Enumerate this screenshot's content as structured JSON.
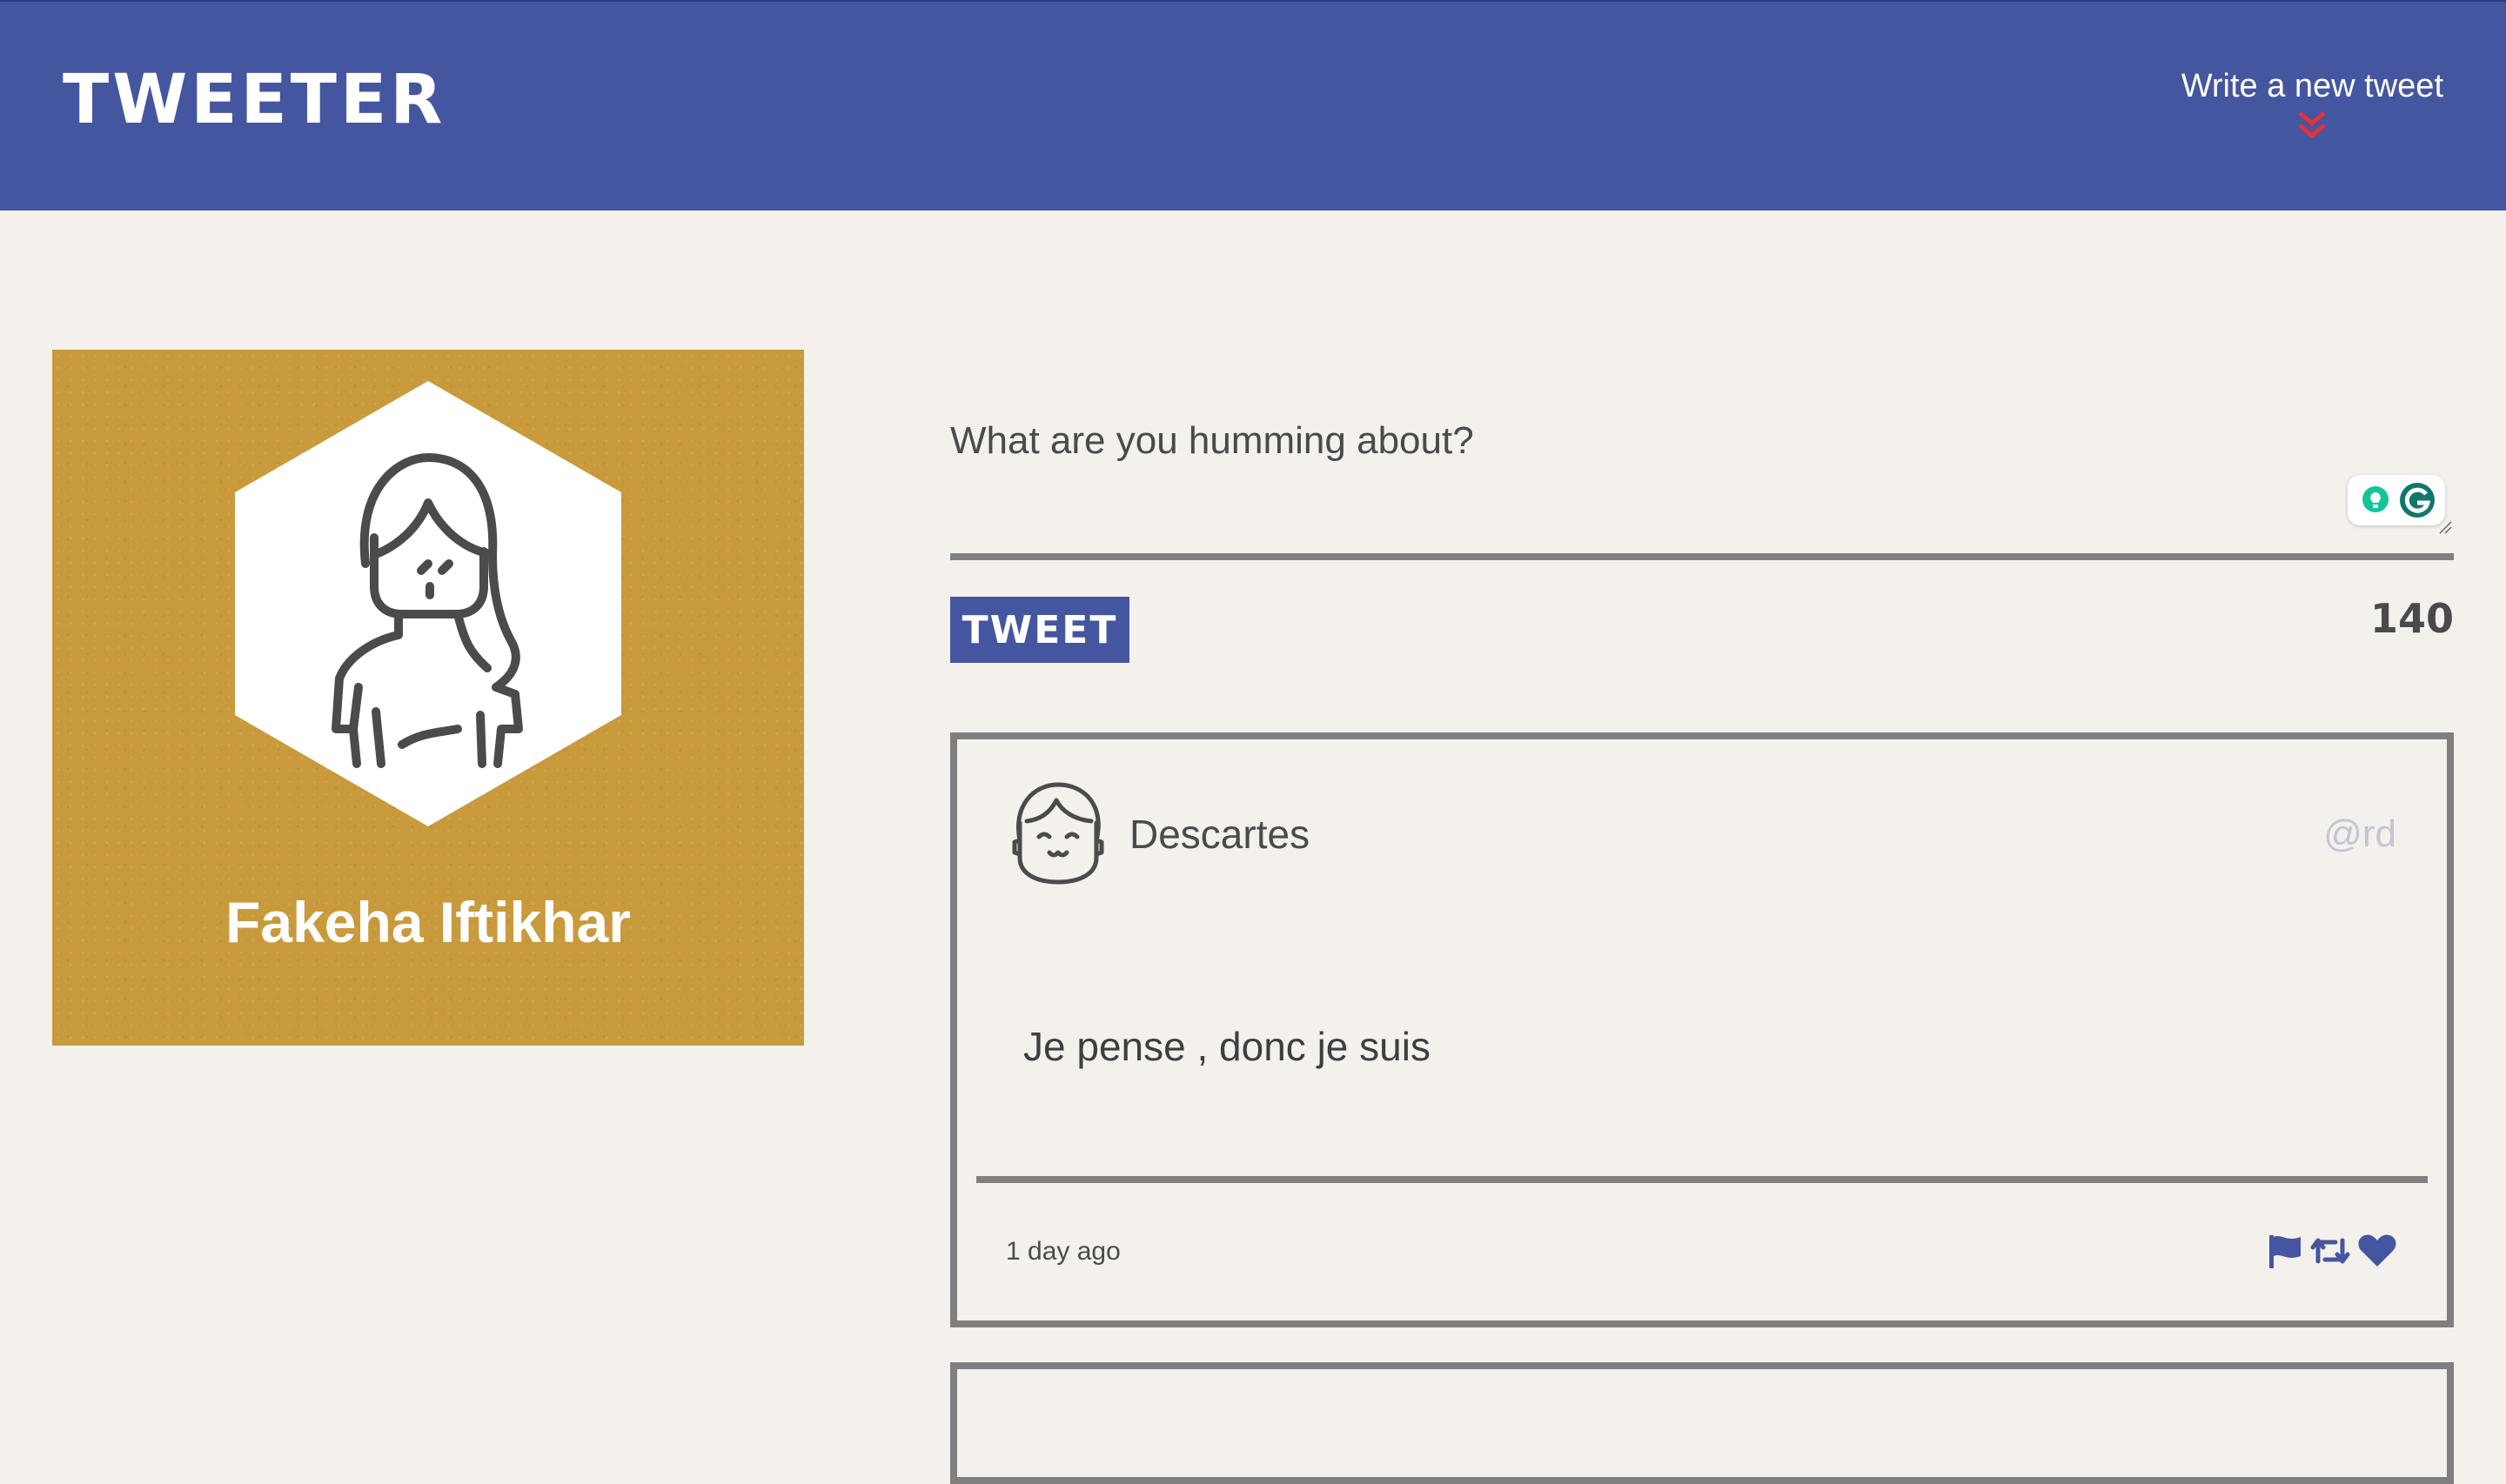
{
  "header": {
    "brand": "TWEETER",
    "compose_label": "Write a new tweet",
    "compose_icon": "double-chevron-down-icon",
    "compose_icon_color": "#e8303a"
  },
  "colors": {
    "nav_bg": "#4556a0",
    "page_bg": "#f4f1ec",
    "profile_bg": "#c99a3c",
    "border_gray": "#7f7f7f",
    "handle_color": "#c3c5d6"
  },
  "profile": {
    "name": "Fakeha Iftikhar",
    "avatar_icon": "woman-avatar-icon"
  },
  "composer": {
    "placeholder": "What are you humming about?",
    "value": "",
    "tweet_button_label": "TWEET",
    "char_count": "140"
  },
  "tweets": [
    {
      "author": "Descartes",
      "handle": "@rd",
      "avatar_icon": "smiling-face-avatar-icon",
      "content": "Je pense , donc je suis",
      "timestamp": "1 day ago",
      "actions": [
        "flag-icon",
        "retweet-icon",
        "heart-icon"
      ]
    }
  ]
}
